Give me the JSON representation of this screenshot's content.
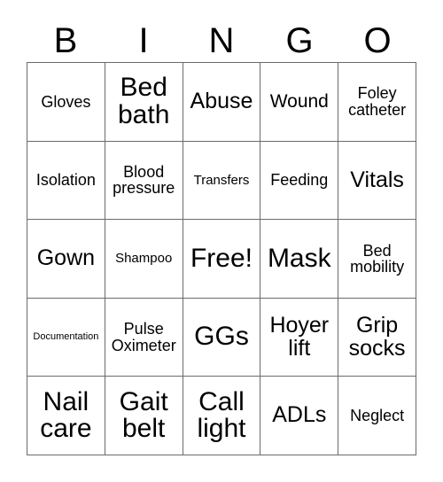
{
  "card": {
    "header_letters": [
      "B",
      "I",
      "N",
      "G",
      "O"
    ],
    "columns": 5,
    "rows": 5,
    "border_color": "#6b6b6b",
    "background_color": "#ffffff",
    "text_color": "#000000",
    "free_space_label": "Free!",
    "free_space_position": "row3-col3"
  },
  "cells": [
    {
      "id": "r1c1",
      "label": "Gloves",
      "size": "md",
      "lines": [
        "Gloves"
      ]
    },
    {
      "id": "r1c2",
      "label": "Bed bath",
      "size": "xxl",
      "lines": [
        "Bed",
        "bath"
      ]
    },
    {
      "id": "r1c3",
      "label": "Abuse",
      "size": "xl",
      "lines": [
        "Abuse"
      ]
    },
    {
      "id": "r1c4",
      "label": "Wound",
      "size": "lg",
      "lines": [
        "Wound"
      ]
    },
    {
      "id": "r1c5",
      "label": "Foley catheter",
      "size": "md",
      "lines": [
        "Foley",
        "catheter"
      ]
    },
    {
      "id": "r2c1",
      "label": "Isolation",
      "size": "md",
      "lines": [
        "Isolation"
      ]
    },
    {
      "id": "r2c2",
      "label": "Blood pressure",
      "size": "md",
      "lines": [
        "Blood",
        "pressure"
      ]
    },
    {
      "id": "r2c3",
      "label": "Transfers",
      "size": "sm",
      "lines": [
        "Transfers"
      ]
    },
    {
      "id": "r2c4",
      "label": "Feeding",
      "size": "md",
      "lines": [
        "Feeding"
      ]
    },
    {
      "id": "r2c5",
      "label": "Vitals",
      "size": "xl",
      "lines": [
        "Vitals"
      ]
    },
    {
      "id": "r3c1",
      "label": "Gown",
      "size": "xl",
      "lines": [
        "Gown"
      ]
    },
    {
      "id": "r3c2",
      "label": "Shampoo",
      "size": "sm",
      "lines": [
        "Shampoo"
      ]
    },
    {
      "id": "r3c3",
      "label": "Free!",
      "size": "xxl",
      "lines": [
        "Free!"
      ]
    },
    {
      "id": "r3c4",
      "label": "Mask",
      "size": "xxl",
      "lines": [
        "Mask"
      ]
    },
    {
      "id": "r3c5",
      "label": "Bed mobility",
      "size": "md",
      "lines": [
        "Bed",
        "mobility"
      ]
    },
    {
      "id": "r4c1",
      "label": "Documentation",
      "size": "xs",
      "lines": [
        "Documentation"
      ]
    },
    {
      "id": "r4c2",
      "label": "Pulse Oximeter",
      "size": "md",
      "lines": [
        "Pulse",
        "Oximeter"
      ]
    },
    {
      "id": "r4c3",
      "label": "GGs",
      "size": "xxl",
      "lines": [
        "GGs"
      ]
    },
    {
      "id": "r4c4",
      "label": "Hoyer lift",
      "size": "xl",
      "lines": [
        "Hoyer",
        "lift"
      ]
    },
    {
      "id": "r4c5",
      "label": "Grip socks",
      "size": "xl",
      "lines": [
        "Grip",
        "socks"
      ]
    },
    {
      "id": "r5c1",
      "label": "Nail care",
      "size": "xxl",
      "lines": [
        "Nail",
        "care"
      ]
    },
    {
      "id": "r5c2",
      "label": "Gait belt",
      "size": "xxl",
      "lines": [
        "Gait",
        "belt"
      ]
    },
    {
      "id": "r5c3",
      "label": "Call light",
      "size": "xxl",
      "lines": [
        "Call",
        "light"
      ]
    },
    {
      "id": "r5c4",
      "label": "ADLs",
      "size": "xl",
      "lines": [
        "ADLs"
      ]
    },
    {
      "id": "r5c5",
      "label": "Neglect",
      "size": "md",
      "lines": [
        "Neglect"
      ]
    }
  ]
}
